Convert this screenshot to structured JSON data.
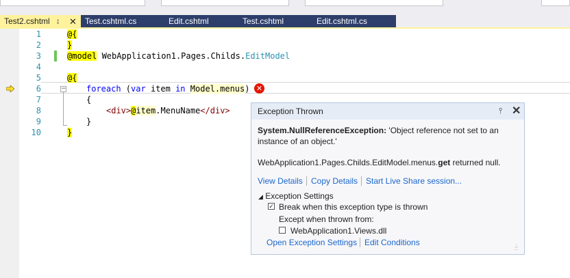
{
  "tabs": [
    {
      "label": "Test2.cshtml",
      "active": true
    },
    {
      "label": "Test.cshtml.cs",
      "active": false
    },
    {
      "label": "Edit.cshtml",
      "active": false
    },
    {
      "label": "Test.cshtml",
      "active": false
    },
    {
      "label": "Edit.cshtml.cs",
      "active": false
    }
  ],
  "line_numbers": [
    "1",
    "2",
    "3",
    "4",
    "5",
    "6",
    "7",
    "8",
    "9",
    "10"
  ],
  "code": {
    "l1": "@{",
    "l2": "}",
    "l3_directive": "@model",
    "l3_ns": " WebApplication1.Pages.Childs.",
    "l3_type": "EditModel",
    "l5": "@{",
    "l6_foreach": "foreach",
    "l6_open": " (",
    "l6_var": "var",
    "l6_item": " item ",
    "l6_in": "in",
    "l6_space": " ",
    "l6_model": "Model.menus",
    "l6_close": ")",
    "l7": "{",
    "l8_open": "<div>",
    "l8_at": "@",
    "l8_item": "item",
    "l8_prop": ".MenuName",
    "l8_close": "</div>",
    "l9": "}",
    "l10": "}"
  },
  "exception": {
    "title": "Exception Thrown",
    "type": "System.NullReferenceException:",
    "message_part1": " 'Object reference not set to an",
    "message_part2": "instance of an object.'",
    "detail_prefix": "WebApplication1.Pages.Childs.EditModel.menus.",
    "detail_bold": "get",
    "detail_suffix": " returned null.",
    "links": {
      "view_details": "View Details",
      "copy_details": "Copy Details",
      "live_share": "Start Live Share session..."
    },
    "settings_header": "Exception Settings",
    "break_label": "Break when this exception type is thrown",
    "break_checked": true,
    "except_label": "Except when thrown from:",
    "module_label": "WebApplication1.Views.dll",
    "module_checked": false,
    "open_settings": "Open Exception Settings",
    "edit_conditions": "Edit Conditions"
  }
}
